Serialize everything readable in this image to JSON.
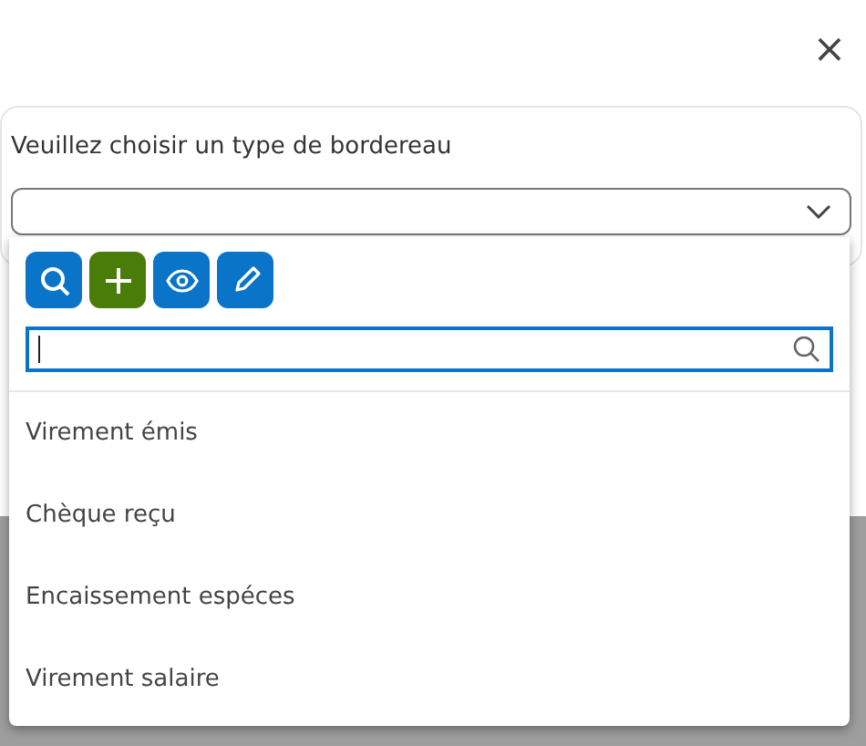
{
  "dialog": {
    "close": "×"
  },
  "form": {
    "label": "Veuillez choisir un type de bordereau",
    "expanded": true
  },
  "toolbar": [
    {
      "kind": "search"
    },
    {
      "kind": "add"
    },
    {
      "kind": "view"
    },
    {
      "kind": "edit"
    }
  ],
  "options": [
    "Virement émis",
    "Chèque reçu",
    "Encaissement espéces",
    "Virement salaire"
  ]
}
